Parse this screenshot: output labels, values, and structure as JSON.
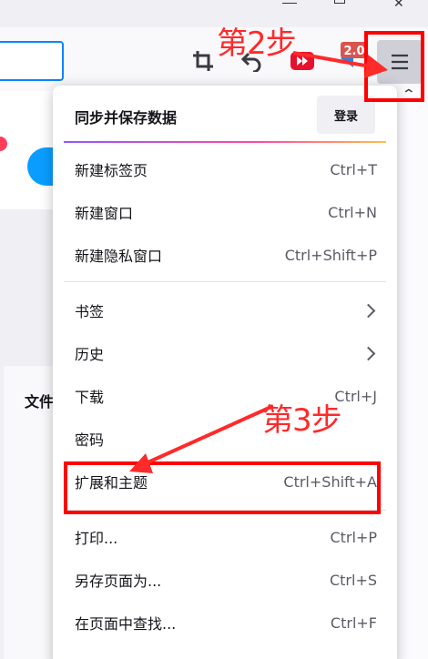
{
  "annotations": {
    "step2": "第2步",
    "step3": "第3步",
    "color": "#ff0000"
  },
  "toolbar": {
    "icons": [
      "crop-icon",
      "undo-icon",
      "youtube-icon",
      "extension-icon",
      "hamburger-menu-icon"
    ],
    "ext_badge": "2.0"
  },
  "background": {
    "card_text": "文件"
  },
  "panel": {
    "title": "同步并保存数据",
    "signin_button": "登录",
    "items": [
      {
        "label": "新建标签页",
        "shortcut": "Ctrl+T"
      },
      {
        "label": "新建窗口",
        "shortcut": "Ctrl+N"
      },
      {
        "label": "新建隐私窗口",
        "shortcut": "Ctrl+Shift+P"
      },
      {
        "label": "书签",
        "submenu": true
      },
      {
        "label": "历史",
        "submenu": true
      },
      {
        "label": "下载",
        "shortcut": "Ctrl+J"
      },
      {
        "label": "密码",
        "shortcut": ""
      },
      {
        "label": "扩展和主题",
        "shortcut": "Ctrl+Shift+A"
      },
      {
        "label": "打印...",
        "shortcut": "Ctrl+P"
      },
      {
        "label": "另存页面为...",
        "shortcut": "Ctrl+S"
      },
      {
        "label": "在页面中查找...",
        "shortcut": "Ctrl+F"
      }
    ]
  }
}
